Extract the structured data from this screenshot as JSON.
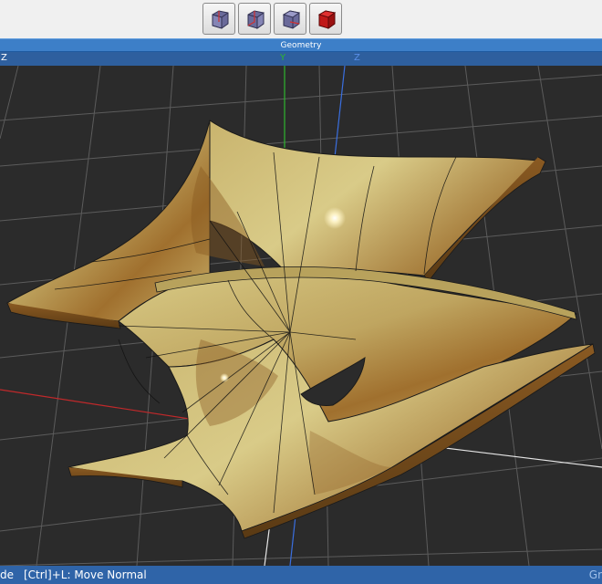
{
  "toolbar": {
    "buttons": [
      {
        "icon": "cube-view-front-icon"
      },
      {
        "icon": "cube-view-side-icon"
      },
      {
        "icon": "cube-view-top-icon"
      },
      {
        "icon": "cube-solid-red-icon"
      }
    ]
  },
  "panel": {
    "title": "Geometry"
  },
  "axes": {
    "left_label": "Z",
    "y_label": "Y",
    "z_label": "Z",
    "colors": {
      "x": "#c0292b",
      "y": "#2fb52f",
      "z": "#3a6fe0"
    }
  },
  "status": {
    "left": "de",
    "hint": "[Ctrl]+L: Move Normal",
    "right": "Gr"
  },
  "colors": {
    "accent": "#3d7fc8",
    "surface_gold": "#c9b873",
    "surface_bronze": "#9c6a2c",
    "grid": "#5a5a5a"
  }
}
